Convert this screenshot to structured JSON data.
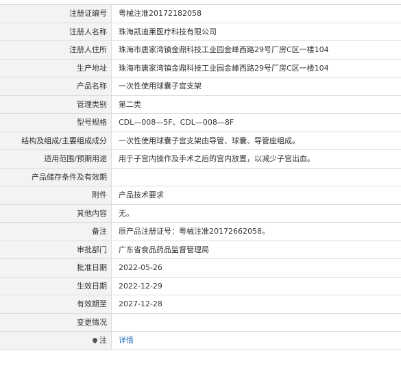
{
  "rows": [
    {
      "label": "注册证编号",
      "value": "粤械注准20172182058"
    },
    {
      "label": "注册人名称",
      "value": "珠海凯迪莱医疗科技有限公司"
    },
    {
      "label": "注册人住所",
      "value": "珠海市唐家湾镇金鼎科技工业园金峰西路29号厂房C区一楼104"
    },
    {
      "label": "生产地址",
      "value": "珠海市唐家湾镇金鼎科技工业园金峰西路29号厂房C区一楼104"
    },
    {
      "label": "产品名称",
      "value": "一次性使用球囊子宫支架"
    },
    {
      "label": "管理类别",
      "value": "第二类"
    },
    {
      "label": "型号规格",
      "value": "CDL—008—5F、CDL—008—8F"
    },
    {
      "label": "结构及组成/主要组成成分",
      "value": "一次性使用球囊子宫支架由导管、球囊、导管座组成。"
    },
    {
      "label": "适用范围/预期用途",
      "value": "用于子宫内操作及手术之后的宫内放置，以减少子宫出血。"
    },
    {
      "label": "产品储存条件及有效期",
      "value": ""
    },
    {
      "label": "附件",
      "value": "产品技术要求"
    },
    {
      "label": "其他内容",
      "value": "无。"
    },
    {
      "label": "备注",
      "value": "原产品注册证号：粤械注准20172662058。"
    },
    {
      "label": "审批部门",
      "value": "广东省食品药品监督管理局"
    },
    {
      "label": "批准日期",
      "value": "2022-05-26"
    },
    {
      "label": "生效日期",
      "value": "2022-12-29"
    },
    {
      "label": "有效期至",
      "value": "2027-12-28"
    },
    {
      "label": "变更情况",
      "value": ""
    }
  ],
  "note_row": {
    "label": "注",
    "icon": "pin-icon",
    "link_text": "详情"
  }
}
